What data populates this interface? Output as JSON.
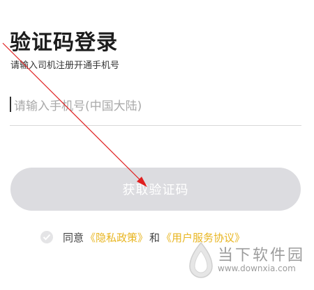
{
  "login": {
    "title": "验证码登录",
    "subtitle": "请输入司机注册开通手机号",
    "phone_placeholder": "请输入手机号(中国大陆)",
    "get_code_label": "获取验证码"
  },
  "agreement": {
    "prefix": "同意",
    "privacy_link": "《隐私政策》",
    "and": "和",
    "service_link": "《用户服务协议》"
  },
  "watermark": {
    "name": "当下软件园",
    "url": "www.downxia.com"
  },
  "colors": {
    "accent": "#e8b520",
    "button_disabled": "#dcdce0",
    "annotation_arrow": "#e02020"
  }
}
